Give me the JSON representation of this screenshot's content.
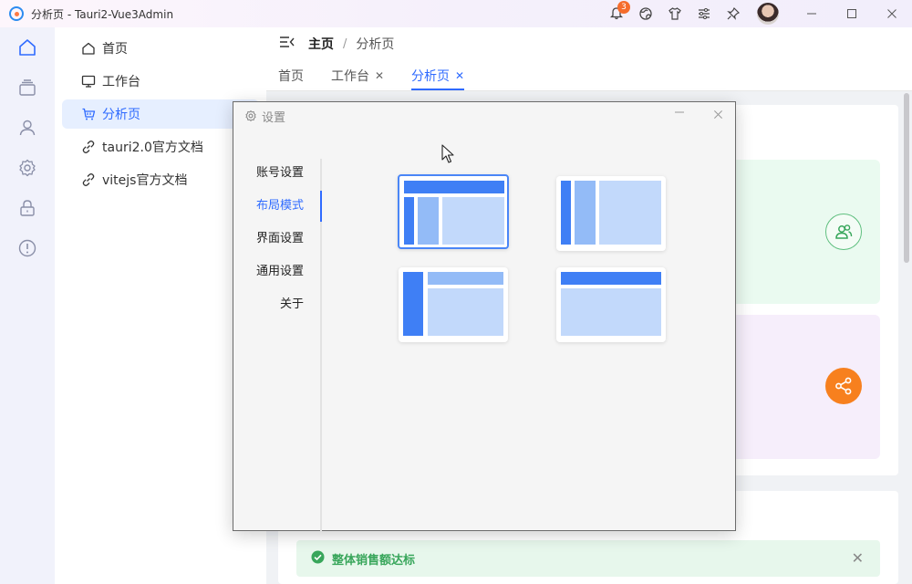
{
  "window": {
    "title": "分析页 - Tauri2-Vue3Admin",
    "notification_count": "3",
    "icons": [
      "bell-icon",
      "globe-icon",
      "shirt-icon",
      "sliders-icon",
      "pin-icon",
      "avatar",
      "minimize-icon",
      "maximize-icon",
      "close-icon"
    ]
  },
  "iconbar": {
    "items": [
      "home-icon",
      "layers-icon",
      "user-icon",
      "settings-icon",
      "lock-icon",
      "alert-icon"
    ]
  },
  "sidebar": {
    "items": [
      {
        "label": "首页",
        "icon": "home-icon"
      },
      {
        "label": "工作台",
        "icon": "monitor-icon"
      },
      {
        "label": "分析页",
        "icon": "cart-icon",
        "active": true
      },
      {
        "label": "tauri2.0官方文档",
        "icon": "link-icon"
      },
      {
        "label": "vitejs官方文档",
        "icon": "link-icon"
      }
    ]
  },
  "breadcrumb": {
    "home": "主页",
    "separator": "/",
    "current": "分析页"
  },
  "tabs": [
    {
      "label": "首页",
      "closable": false
    },
    {
      "label": "工作台",
      "closable": true
    },
    {
      "label": "分析页",
      "closable": true,
      "active": true
    }
  ],
  "alert": {
    "text": "整体销售额达标",
    "type": "success"
  },
  "dialog": {
    "title": "设置",
    "menu": [
      "账号设置",
      "布局模式",
      "界面设置",
      "通用设置",
      "关于"
    ],
    "active_menu": "布局模式",
    "layouts": [
      "top-header-side-split",
      "dual-sidebar",
      "side-with-header",
      "top-header"
    ],
    "selected_layout": "top-header-side-split"
  },
  "colors": {
    "accent": "#2f6bff",
    "success": "#38a65b",
    "orange": "#f7801e",
    "layout_dark": "#3f7ff5",
    "layout_light": "#c2d9fb"
  }
}
